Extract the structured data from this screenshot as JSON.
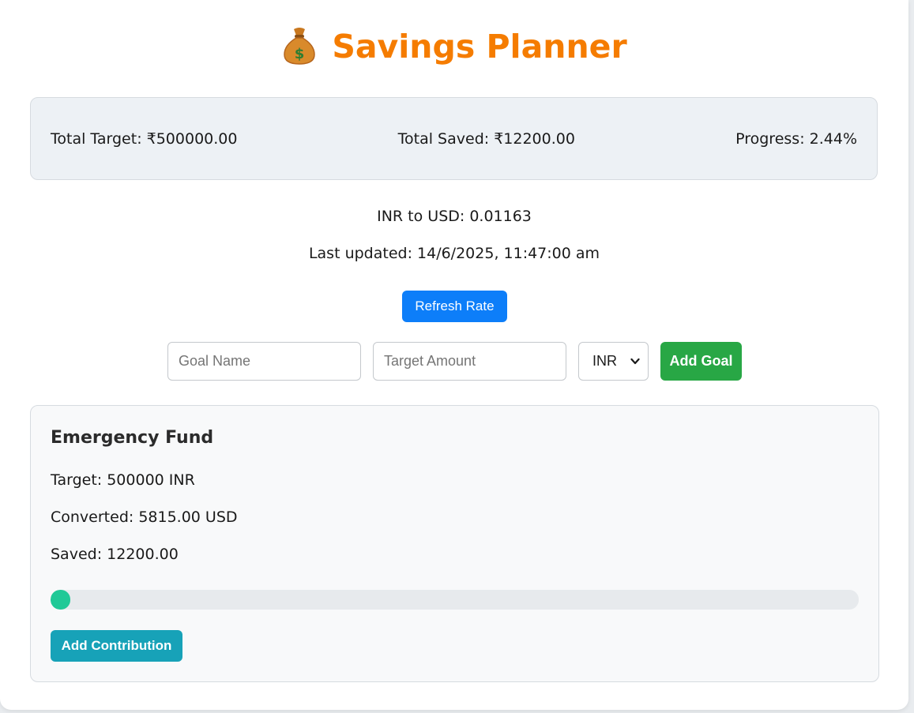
{
  "app": {
    "title": "Savings Planner",
    "title_icon": "money-bag-icon",
    "accent_color": "#f57c00"
  },
  "summary": {
    "total_target": "Total Target: ₹500000.00",
    "total_saved": "Total Saved: ₹12200.00",
    "progress": "Progress: 2.44%"
  },
  "rate": {
    "text": "INR to USD: 0.01163",
    "last_updated": "Last updated: 14/6/2025, 11:47:00 am",
    "refresh_label": "Refresh Rate"
  },
  "form": {
    "goal_name_placeholder": "Goal Name",
    "target_amount_placeholder": "Target Amount",
    "currency_selected": "INR",
    "add_goal_label": "Add Goal"
  },
  "goals": [
    {
      "name": "Emergency Fund",
      "target": "Target: 500000 INR",
      "converted": "Converted: 5815.00 USD",
      "saved": "Saved: 12200.00",
      "progress_fraction": 0.0244,
      "progress_color": "#20c997",
      "contribution_label": "Add Contribution"
    }
  ]
}
